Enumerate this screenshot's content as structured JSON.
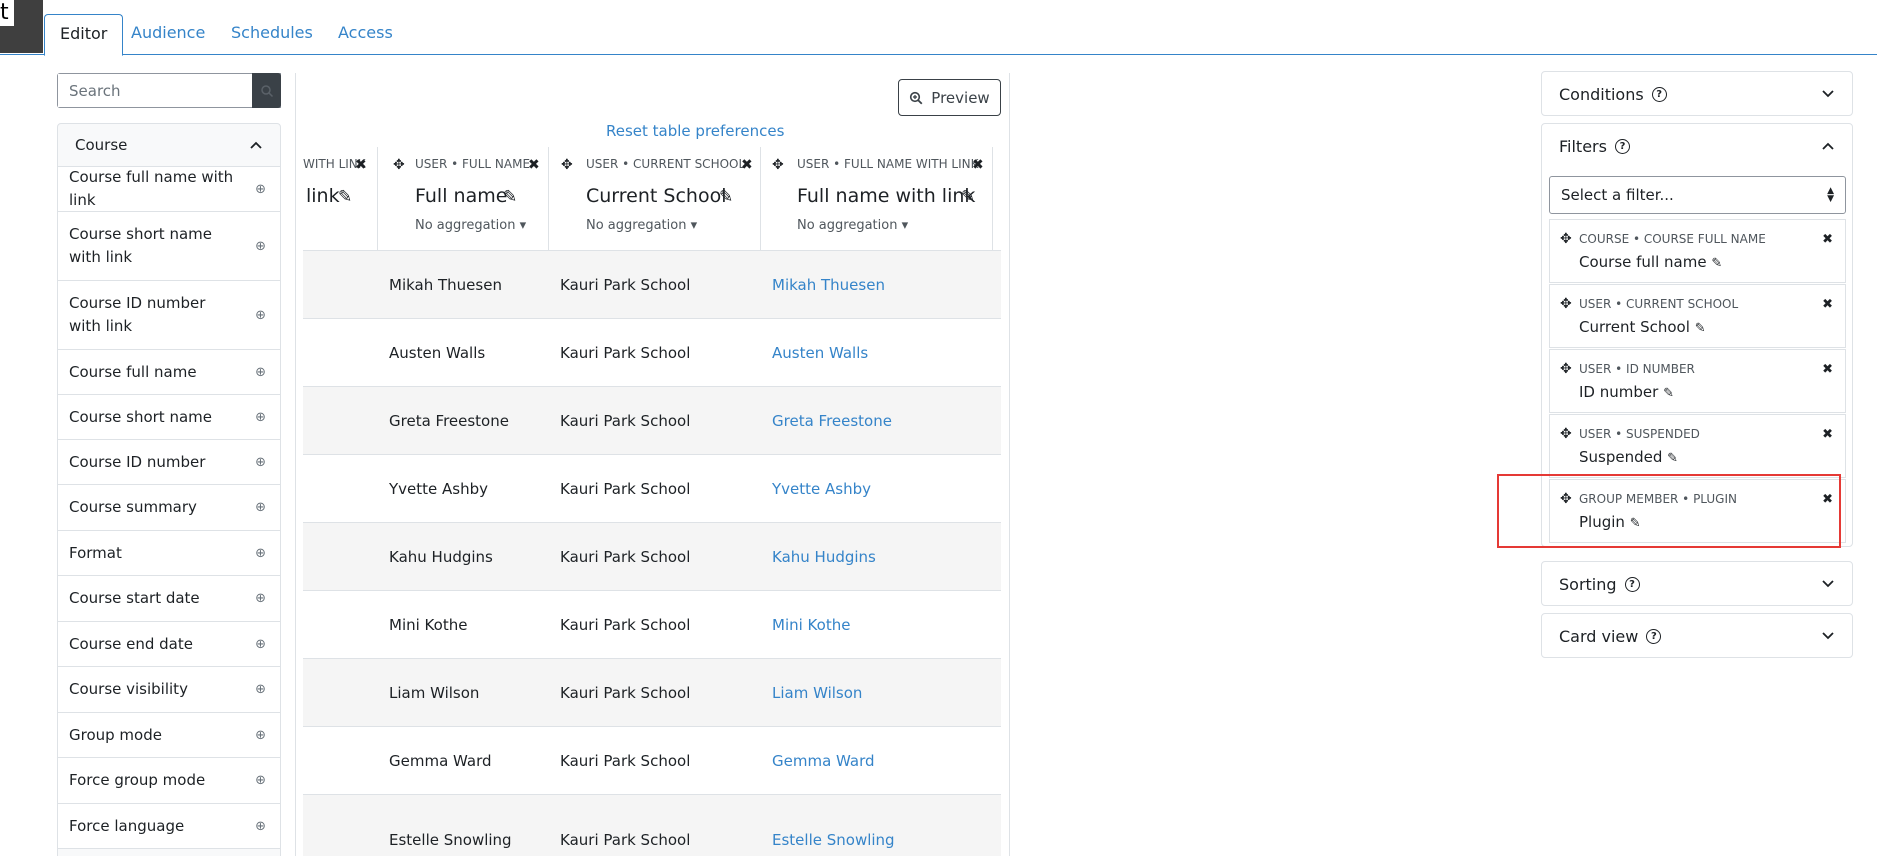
{
  "corner_letter": "t",
  "tabs": [
    {
      "label": "Editor"
    },
    {
      "label": "Audience"
    },
    {
      "label": "Schedules"
    },
    {
      "label": "Access"
    }
  ],
  "search": {
    "placeholder": "Search"
  },
  "sidebar": {
    "section_title": "Course",
    "fields": [
      "Course full name with link",
      "Course short name with link",
      "Course ID number with link",
      "Course full name",
      "Course short name",
      "Course ID number",
      "Course summary",
      "Format",
      "Course start date",
      "Course end date",
      "Course visibility",
      "Group mode",
      "Force group mode",
      "Force language"
    ]
  },
  "toolbar": {
    "preview_label": "Preview",
    "reset_label": "Reset table preferences"
  },
  "columns": [
    {
      "category": "WITH LINK",
      "name": "link",
      "aggregation": ""
    },
    {
      "category": "USER • FULL NAME",
      "name": "Full name",
      "aggregation": "No aggregation"
    },
    {
      "category": "USER • CURRENT SCHOOL",
      "name": "Current School",
      "aggregation": "No aggregation"
    },
    {
      "category": "USER • FULL NAME WITH LINK",
      "name": "Full name with link",
      "aggregation": "No aggregation"
    }
  ],
  "rows": [
    {
      "full_name": "Mikah Thuesen",
      "school": "Kauri Park School",
      "link": "Mikah Thuesen"
    },
    {
      "full_name": "Austen Walls",
      "school": "Kauri Park School",
      "link": "Austen Walls"
    },
    {
      "full_name": "Greta Freestone",
      "school": "Kauri Park School",
      "link": "Greta Freestone"
    },
    {
      "full_name": "Yvette Ashby",
      "school": "Kauri Park School",
      "link": "Yvette Ashby"
    },
    {
      "full_name": "Kahu Hudgins",
      "school": "Kauri Park School",
      "link": "Kahu Hudgins"
    },
    {
      "full_name": "Mini Kothe",
      "school": "Kauri Park School",
      "link": "Mini Kothe"
    },
    {
      "full_name": "Liam Wilson",
      "school": "Kauri Park School",
      "link": "Liam Wilson"
    },
    {
      "full_name": "Gemma Ward",
      "school": "Kauri Park School",
      "link": "Gemma Ward"
    },
    {
      "full_name": "Estelle Snowling",
      "school": "Kauri Park School",
      "link": "Estelle Snowling"
    }
  ],
  "right_panel": {
    "conditions_title": "Conditions",
    "filters_title": "Filters",
    "select_placeholder": "Select a filter...",
    "filters": [
      {
        "category": "COURSE • COURSE FULL NAME",
        "name": "Course full name"
      },
      {
        "category": "USER • CURRENT SCHOOL",
        "name": "Current School"
      },
      {
        "category": "USER • ID NUMBER",
        "name": "ID number"
      },
      {
        "category": "USER • SUSPENDED",
        "name": "Suspended"
      },
      {
        "category": "GROUP MEMBER • PLUGIN",
        "name": "Plugin"
      }
    ],
    "sorting_title": "Sorting",
    "cardview_title": "Card view"
  },
  "colors": {
    "accent": "#3584c9",
    "highlight": "#e53935"
  }
}
